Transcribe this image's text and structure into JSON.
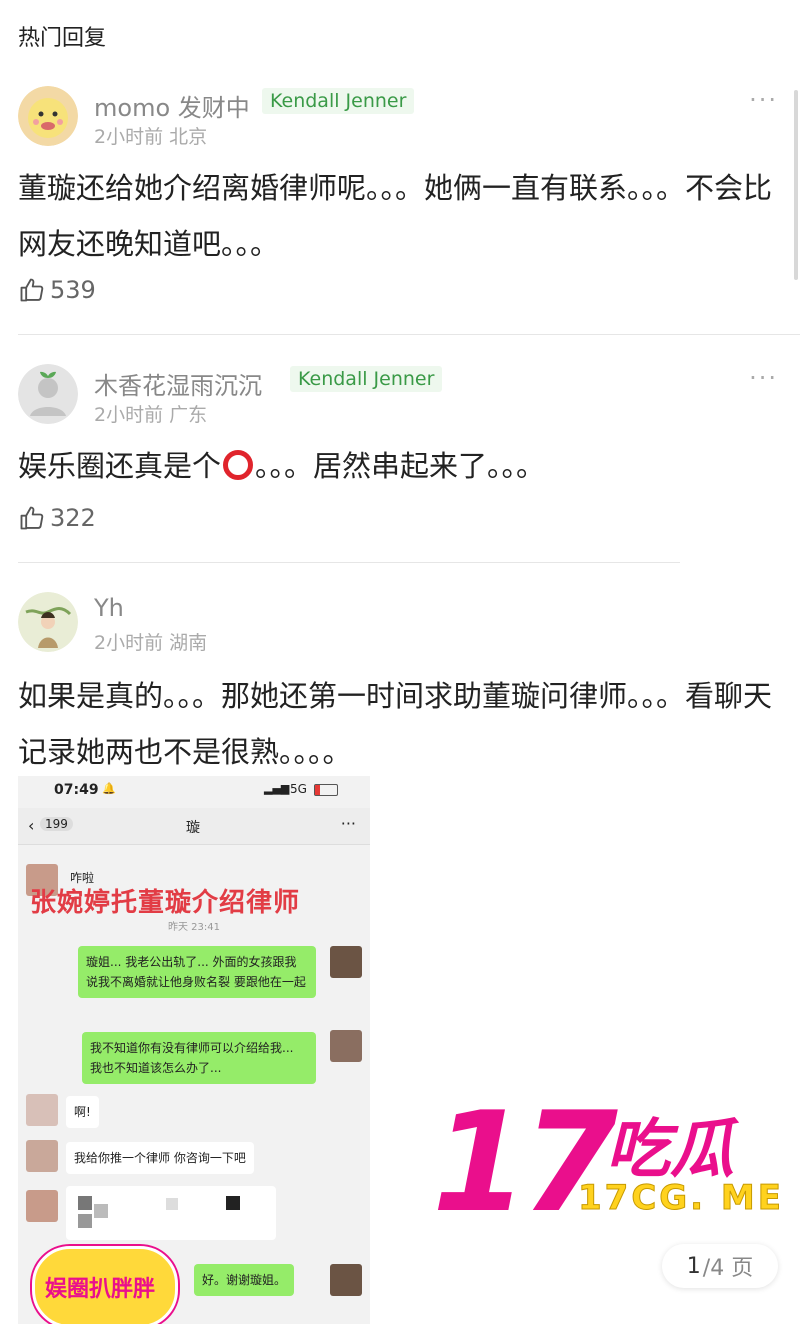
{
  "section_title": "热门回复",
  "comments": [
    {
      "name": "momo 发财中",
      "badge": "Kendall Jenner",
      "meta": "2小时前 北京",
      "text": "董璇还给她介绍离婚律师呢。。。她俩一直有联系。。。不会比网友还晚知道吧。。。",
      "likes": "539"
    },
    {
      "name": "木香花湿雨沉沉",
      "badge": "Kendall Jenner",
      "meta": "2小时前 广东",
      "text_before": "娱乐圈还真是个",
      "text_after": "。。。居然串起来了。。。",
      "likes": "322"
    },
    {
      "name": "Yh",
      "meta": "2小时前 湖南",
      "text": "如果是真的。。。那她还第一时间求助董璇问律师。。。看聊天记录她两也不是很熟。。。。"
    }
  ],
  "more_glyph": "···",
  "screenshot": {
    "time": "07:49",
    "signal": "5G",
    "back_count": "199",
    "chat_title": "璇",
    "more": "···",
    "msg1": "咋啦",
    "overlay_title": "张婉婷托董璇介绍律师",
    "timestamp": "昨天 23:41",
    "msg2": "璇姐... 我老公出轨了... 外面的女孩跟我说我不离婚就让他身败名裂 要跟他在一起",
    "msg3": "我不知道你有没有律师可以介绍给我... 我也不知道该怎么办了...",
    "msg4": "啊!",
    "msg5": "我给你推一个律师 你咨询一下吧",
    "msg6": "好。谢谢璇姐。",
    "sticker_text": "娱圈扒胖胖"
  },
  "watermark": {
    "number": "17",
    "brand": "吃瓜",
    "url": "17CG. ME"
  },
  "pager": {
    "current": "1",
    "total": "/4 页"
  },
  "colors": {
    "badge_green": "#3a9a47",
    "logo_pink": "#ea0f8c",
    "logo_yellow": "#ffd21e",
    "chat_green": "#95ec69"
  }
}
